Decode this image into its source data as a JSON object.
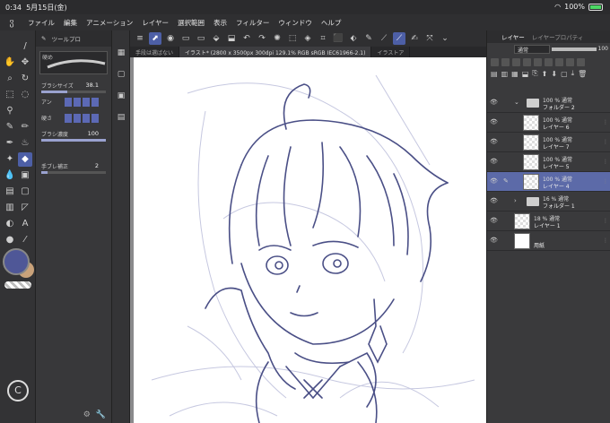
{
  "status": {
    "time": "0:34",
    "date": "5月15日(金)",
    "battery": "100%"
  },
  "menu": {
    "items": [
      "ファイル",
      "編集",
      "アニメーション",
      "レイヤー",
      "選択範囲",
      "表示",
      "フィルター",
      "ウィンドウ",
      "ヘルプ"
    ]
  },
  "toolprop": {
    "tabs": [
      "ツールプロ"
    ],
    "brush_name": "硬め",
    "brush_size_label": "ブラシサイズ",
    "brush_size_value": "38.1",
    "anti_label": "アン",
    "hardness_label": "硬さ",
    "density_label": "ブラシ濃度",
    "density_value": "100",
    "stabilize_label": "手ブレ補正",
    "stabilize_value": "2"
  },
  "doc_tabs": [
    "手段は選ばない",
    "イラスト* (2800 x 3500px 300dpi 129.1%  RGB sRGB IEC61966-2.1)",
    "イラストア"
  ],
  "layer_panel": {
    "tabs": [
      "レイヤー",
      "レイヤープロパティ"
    ],
    "blend_mode": "通常",
    "opacity": "100",
    "layers": [
      {
        "line1": "100 %  通常",
        "line2": "フォルダー 2",
        "type": "folder",
        "expanded": true
      },
      {
        "line1": "100 %  通常",
        "line2": "レイヤー 6",
        "type": "layer"
      },
      {
        "line1": "100 %  通常",
        "line2": "レイヤー 7",
        "type": "layer"
      },
      {
        "line1": "100 %  通常",
        "line2": "レイヤー 5",
        "type": "layer"
      },
      {
        "line1": "100 %  通常",
        "line2": "レイヤー 4",
        "type": "layer",
        "selected": true
      },
      {
        "line1": "16 %  通常",
        "line2": "フォルダー 1",
        "type": "folder",
        "expanded": false
      },
      {
        "line1": "18 %  通常",
        "line2": "レイヤー 1",
        "type": "layer"
      },
      {
        "line1": "",
        "line2": "用紙",
        "type": "paper"
      }
    ]
  },
  "colors": {
    "main": "#4f5797",
    "sub": "#c9a27a",
    "accent": "#4d5fa6"
  }
}
